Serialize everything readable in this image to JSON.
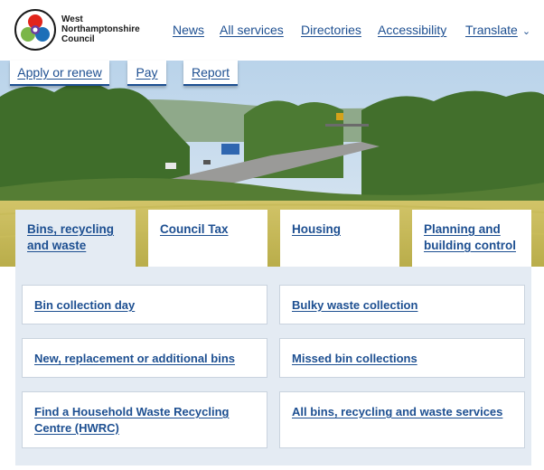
{
  "header": {
    "logo_lines": [
      "West",
      "Northamptonshire",
      "Council"
    ],
    "nav": [
      "News",
      "All services",
      "Directories",
      "Accessibility",
      "Translate"
    ]
  },
  "quick_links": [
    "Apply or renew",
    "Pay",
    "Report"
  ],
  "tabs": [
    "Bins, recycling and waste",
    "Council Tax",
    "Housing",
    "Planning and building control"
  ],
  "active_tab": "Bins, recycling and waste",
  "cards": [
    "Bin collection day",
    "Bulky waste collection",
    "New, replacement or additional bins",
    "Missed bin collections",
    "Find a Household Waste Recycling Centre (HWRC)",
    "All bins, recycling and waste services"
  ],
  "colors": {
    "link": "#1d4f91",
    "panel": "#e4ebf3"
  },
  "icons": {
    "logo": "council-logo-icon",
    "translate": "chevron-down-icon"
  }
}
